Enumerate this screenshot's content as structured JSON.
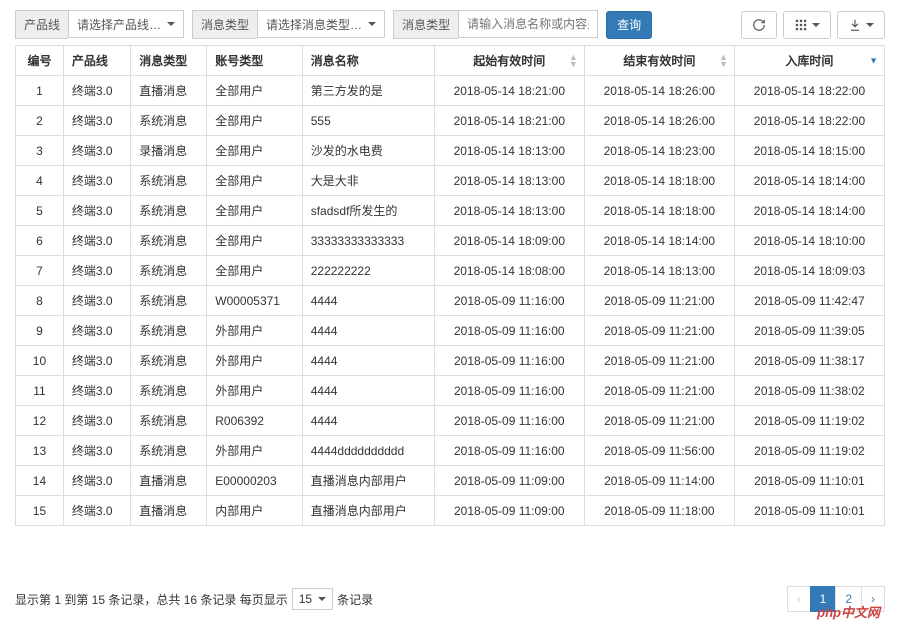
{
  "filters": {
    "product_label": "产品线",
    "product_placeholder": "请选择产品线…",
    "type_label": "消息类型",
    "type_placeholder": "请选择消息类型…",
    "keyword_label": "消息类型",
    "keyword_placeholder": "请输入消息名称或内容关键",
    "query_btn": "查询"
  },
  "columns": {
    "no": "编号",
    "product": "产品线",
    "msg_type": "消息类型",
    "account_type": "账号类型",
    "msg_name": "消息名称",
    "start_time": "起始有效时间",
    "end_time": "结束有效时间",
    "store_time": "入库时间"
  },
  "rows": [
    {
      "no": "1",
      "product": "终端3.0",
      "msg_type": "直播消息",
      "account_type": "全部用户",
      "msg_name": "第三方发的是",
      "start": "2018-05-14 18:21:00",
      "end": "2018-05-14 18:26:00",
      "store": "2018-05-14 18:22:00"
    },
    {
      "no": "2",
      "product": "终端3.0",
      "msg_type": "系统消息",
      "account_type": "全部用户",
      "msg_name": "555",
      "start": "2018-05-14 18:21:00",
      "end": "2018-05-14 18:26:00",
      "store": "2018-05-14 18:22:00"
    },
    {
      "no": "3",
      "product": "终端3.0",
      "msg_type": "录播消息",
      "account_type": "全部用户",
      "msg_name": "沙发的水电费",
      "start": "2018-05-14 18:13:00",
      "end": "2018-05-14 18:23:00",
      "store": "2018-05-14 18:15:00"
    },
    {
      "no": "4",
      "product": "终端3.0",
      "msg_type": "系统消息",
      "account_type": "全部用户",
      "msg_name": "大是大非",
      "start": "2018-05-14 18:13:00",
      "end": "2018-05-14 18:18:00",
      "store": "2018-05-14 18:14:00"
    },
    {
      "no": "5",
      "product": "终端3.0",
      "msg_type": "系统消息",
      "account_type": "全部用户",
      "msg_name": "sfadsdf所发生的",
      "start": "2018-05-14 18:13:00",
      "end": "2018-05-14 18:18:00",
      "store": "2018-05-14 18:14:00"
    },
    {
      "no": "6",
      "product": "终端3.0",
      "msg_type": "系统消息",
      "account_type": "全部用户",
      "msg_name": "33333333333333",
      "start": "2018-05-14 18:09:00",
      "end": "2018-05-14 18:14:00",
      "store": "2018-05-14 18:10:00"
    },
    {
      "no": "7",
      "product": "终端3.0",
      "msg_type": "系统消息",
      "account_type": "全部用户",
      "msg_name": "222222222",
      "start": "2018-05-14 18:08:00",
      "end": "2018-05-14 18:13:00",
      "store": "2018-05-14 18:09:03"
    },
    {
      "no": "8",
      "product": "终端3.0",
      "msg_type": "系统消息",
      "account_type": "W00005371",
      "msg_name": "4444",
      "start": "2018-05-09 11:16:00",
      "end": "2018-05-09 11:21:00",
      "store": "2018-05-09 11:42:47"
    },
    {
      "no": "9",
      "product": "终端3.0",
      "msg_type": "系统消息",
      "account_type": "外部用户",
      "msg_name": "4444",
      "start": "2018-05-09 11:16:00",
      "end": "2018-05-09 11:21:00",
      "store": "2018-05-09 11:39:05"
    },
    {
      "no": "10",
      "product": "终端3.0",
      "msg_type": "系统消息",
      "account_type": "外部用户",
      "msg_name": "4444",
      "start": "2018-05-09 11:16:00",
      "end": "2018-05-09 11:21:00",
      "store": "2018-05-09 11:38:17"
    },
    {
      "no": "11",
      "product": "终端3.0",
      "msg_type": "系统消息",
      "account_type": "外部用户",
      "msg_name": "4444",
      "start": "2018-05-09 11:16:00",
      "end": "2018-05-09 11:21:00",
      "store": "2018-05-09 11:38:02"
    },
    {
      "no": "12",
      "product": "终端3.0",
      "msg_type": "系统消息",
      "account_type": "R006392",
      "msg_name": "4444",
      "start": "2018-05-09 11:16:00",
      "end": "2018-05-09 11:21:00",
      "store": "2018-05-09 11:19:02"
    },
    {
      "no": "13",
      "product": "终端3.0",
      "msg_type": "系统消息",
      "account_type": "外部用户",
      "msg_name": "4444dddddddddd",
      "start": "2018-05-09 11:16:00",
      "end": "2018-05-09 11:56:00",
      "store": "2018-05-09 11:19:02"
    },
    {
      "no": "14",
      "product": "终端3.0",
      "msg_type": "直播消息",
      "account_type": "E00000203",
      "msg_name": "直播消息内部用户",
      "start": "2018-05-09 11:09:00",
      "end": "2018-05-09 11:14:00",
      "store": "2018-05-09 11:10:01"
    },
    {
      "no": "15",
      "product": "终端3.0",
      "msg_type": "直播消息",
      "account_type": "内部用户",
      "msg_name": "直播消息内部用户",
      "start": "2018-05-09 11:09:00",
      "end": "2018-05-09 11:18:00",
      "store": "2018-05-09 11:10:01"
    }
  ],
  "pager": {
    "info_prefix": "显示第 1 到第 15 条记录，总共 16 条记录 每页显示",
    "info_suffix": "条记录",
    "page_size": "15",
    "prev": "‹",
    "next": "›",
    "pages": [
      "1",
      "2"
    ],
    "active": "1"
  },
  "watermark": "php中文网"
}
